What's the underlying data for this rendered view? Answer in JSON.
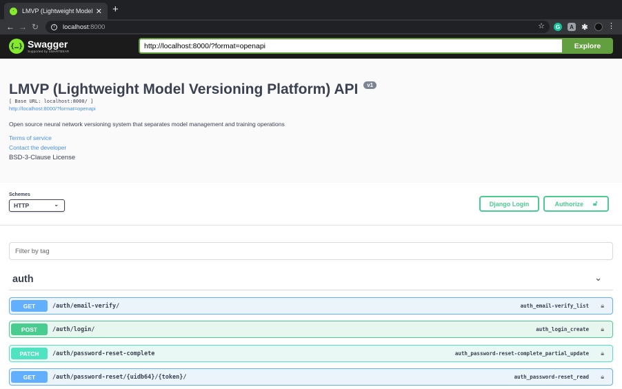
{
  "browser": {
    "tab_title": "LMVP (Lightweight Model Versi",
    "tab_close": "✕",
    "new_tab": "+",
    "address_host": "localhost",
    "address_port": ":8000"
  },
  "topbar": {
    "logo_glyph": "{…}",
    "logo_text": "Swagger",
    "logo_sub": "Supported by SMARTBEAR",
    "url_value": "http://localhost:8000/?format=openapi",
    "explore_label": "Explore",
    "accent_color": "#62a03f"
  },
  "info": {
    "title": "LMVP (Lightweight Model Versioning Platform) API",
    "version": "v1",
    "base_url": "[ Base URL: localhost:8000/ ]",
    "spec_link": "http://localhost:8000/?format=openapi",
    "description": "Open source neural network versioning system that separates model management and training operations",
    "terms": "Terms of service",
    "contact": "Contact the developer",
    "license": "BSD-3-Clause License"
  },
  "schemes": {
    "label": "Schemes",
    "selected": "HTTP",
    "django_login": "Django Login",
    "authorize": "Authorize"
  },
  "filter": {
    "placeholder": "Filter by tag"
  },
  "tag": {
    "name": "auth"
  },
  "operations": [
    {
      "method": "GET",
      "path": "/auth/email-verify/",
      "operation_id": "auth_email-verify_list",
      "color": "#61affe"
    },
    {
      "method": "POST",
      "path": "/auth/login/",
      "operation_id": "auth_login_create",
      "color": "#49cc90"
    },
    {
      "method": "PATCH",
      "path": "/auth/password-reset-complete",
      "operation_id": "auth_password-reset-complete_partial_update",
      "color": "#50e3c2"
    },
    {
      "method": "GET",
      "path": "/auth/password-reset/{uidb64}/{token}/",
      "operation_id": "auth_password-reset_read",
      "color": "#61affe"
    }
  ]
}
